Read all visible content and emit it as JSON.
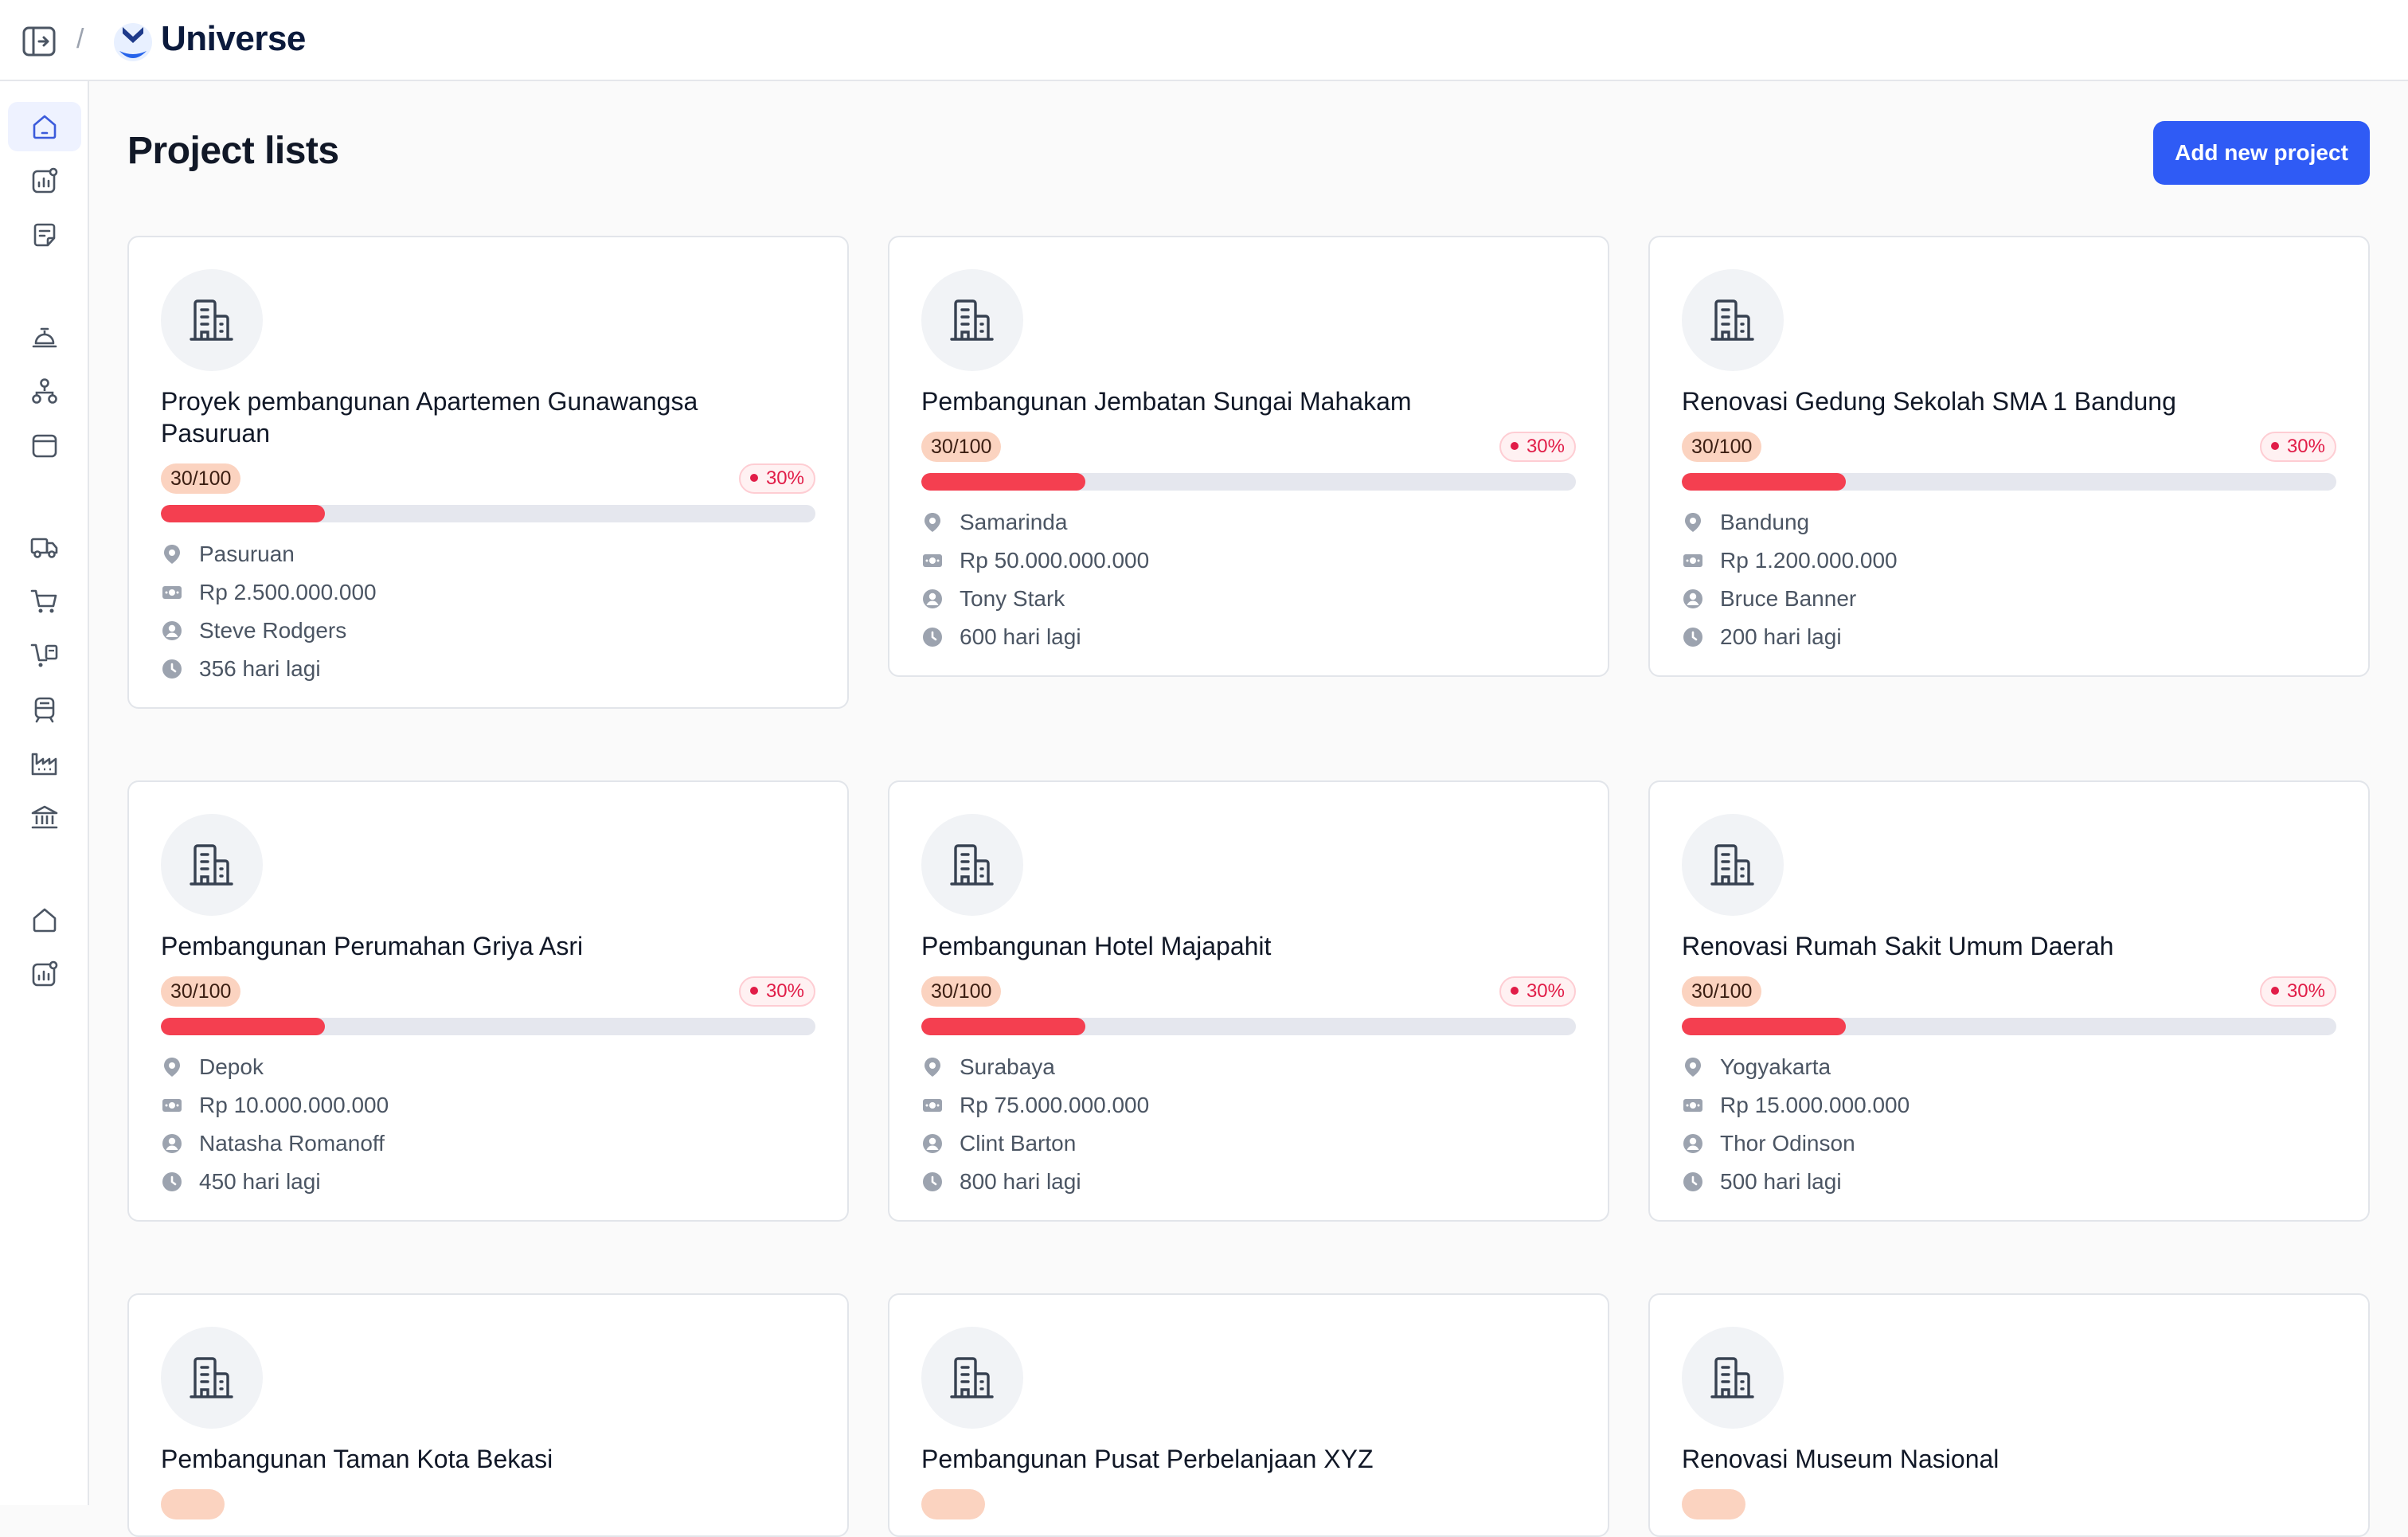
{
  "app": {
    "brand": "Universe",
    "separator": "/"
  },
  "page": {
    "title": "Project lists",
    "add_button": "Add new project"
  },
  "sidebar": {
    "items": [
      {
        "icon": "home-icon",
        "active": true
      },
      {
        "icon": "analytics-icon"
      },
      {
        "icon": "note-icon"
      },
      {
        "icon": "service-bell-icon"
      },
      {
        "icon": "hierarchy-icon"
      },
      {
        "icon": "browser-window-icon"
      },
      {
        "icon": "delivery-truck-icon"
      },
      {
        "icon": "shopping-cart-icon"
      },
      {
        "icon": "cart-invoice-icon"
      },
      {
        "icon": "train-icon"
      },
      {
        "icon": "factory-icon"
      },
      {
        "icon": "bank-icon"
      },
      {
        "icon": "home-outline-icon"
      },
      {
        "icon": "analytics-outline-icon"
      }
    ]
  },
  "colors": {
    "accent": "#2f5bf5",
    "progress": "#f43f50",
    "danger": "#e11d48"
  },
  "projects": [
    {
      "title": "Proyek pembangunan Apartemen Gunawangsa Pasuruan",
      "score": "30/100",
      "percent_label": "30%",
      "progress": 0.25,
      "location": "Pasuruan",
      "budget": "Rp 2.500.000.000",
      "manager": "Steve Rodgers",
      "deadline": "356 hari lagi"
    },
    {
      "title": "Pembangunan Jembatan Sungai Mahakam",
      "score": "30/100",
      "percent_label": "30%",
      "progress": 0.25,
      "location": "Samarinda",
      "budget": "Rp 50.000.000.000",
      "manager": "Tony Stark",
      "deadline": "600 hari lagi"
    },
    {
      "title": "Renovasi Gedung Sekolah SMA 1 Bandung",
      "score": "30/100",
      "percent_label": "30%",
      "progress": 0.25,
      "location": "Bandung",
      "budget": "Rp 1.200.000.000",
      "manager": "Bruce Banner",
      "deadline": "200 hari lagi"
    },
    {
      "title": "Pembangunan Perumahan Griya Asri",
      "score": "30/100",
      "percent_label": "30%",
      "progress": 0.25,
      "location": "Depok",
      "budget": "Rp 10.000.000.000",
      "manager": "Natasha Romanoff",
      "deadline": "450 hari lagi"
    },
    {
      "title": "Pembangunan Hotel Majapahit",
      "score": "30/100",
      "percent_label": "30%",
      "progress": 0.25,
      "location": "Surabaya",
      "budget": "Rp 75.000.000.000",
      "manager": "Clint Barton",
      "deadline": "800 hari lagi"
    },
    {
      "title": "Renovasi Rumah Sakit Umum Daerah",
      "score": "30/100",
      "percent_label": "30%",
      "progress": 0.25,
      "location": "Yogyakarta",
      "budget": "Rp 15.000.000.000",
      "manager": "Thor Odinson",
      "deadline": "500 hari lagi"
    },
    {
      "title": "Pembangunan Taman Kota Bekasi"
    },
    {
      "title": "Pembangunan Pusat Perbelanjaan XYZ"
    },
    {
      "title": "Renovasi Museum Nasional"
    }
  ]
}
